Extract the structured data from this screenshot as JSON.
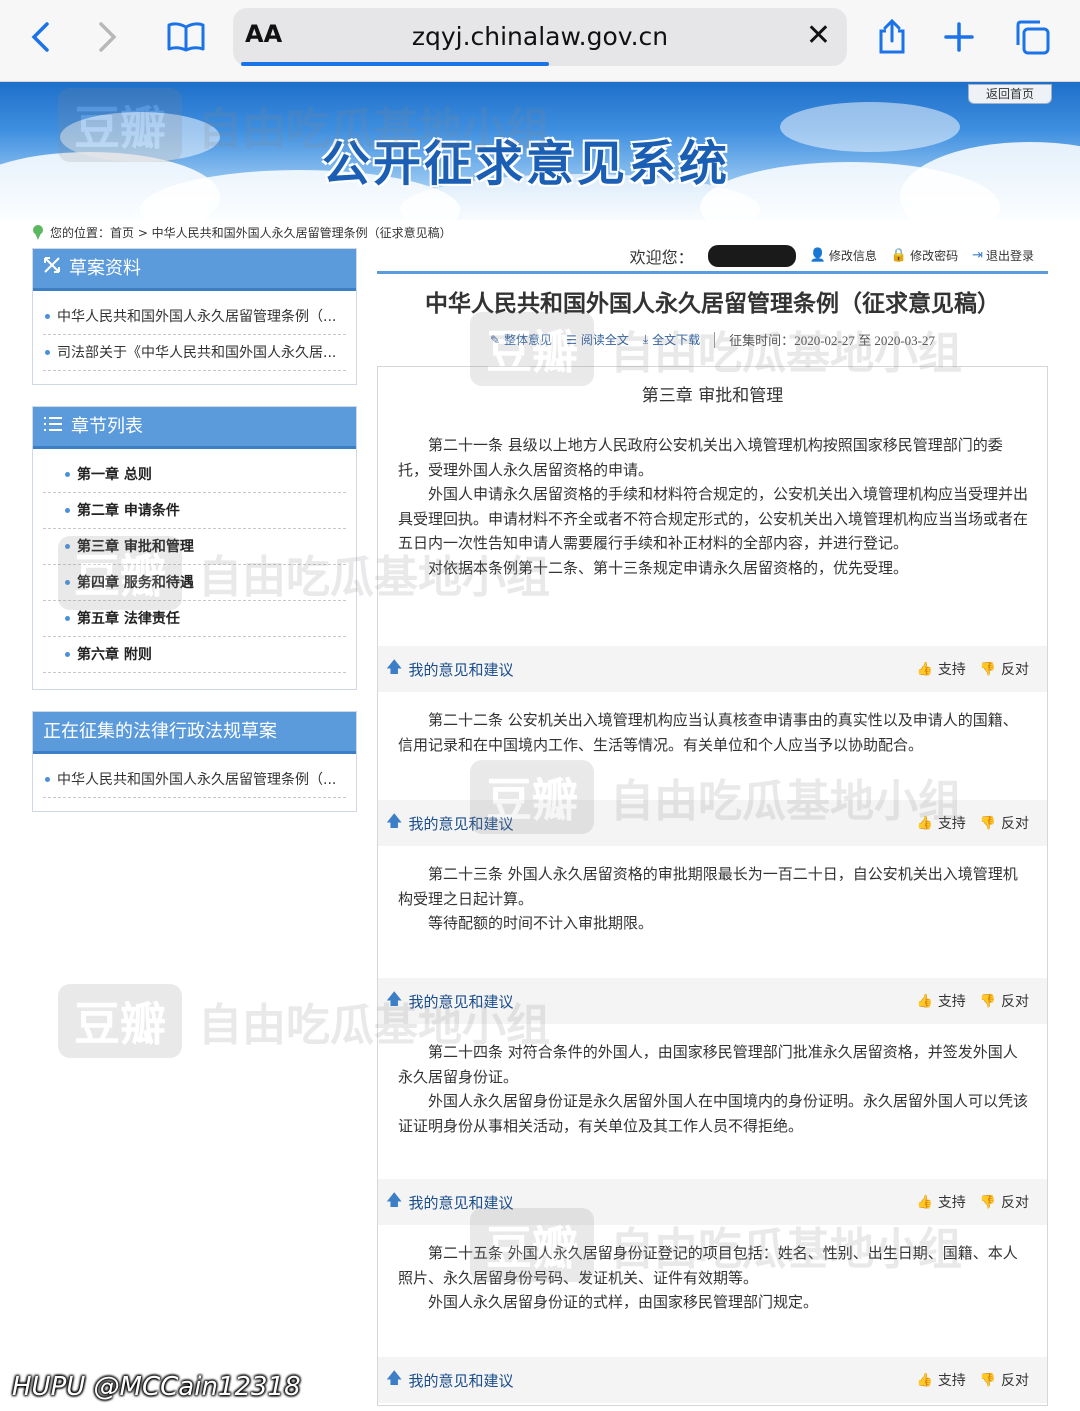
{
  "browser": {
    "url": "zqyj.chinalaw.gov.cn",
    "text_size_label": "AA"
  },
  "banner": {
    "title": "公开征求意见系统",
    "home_button": "返回首页"
  },
  "breadcrumb": {
    "text": "您的位置：首页 > 中华人民共和国外国人永久居留管理条例（征求意见稿）"
  },
  "sidebar": {
    "drafts": {
      "title": "草案资料",
      "items": [
        {
          "label": "中华人民共和国外国人永久居留管理条例（..."
        },
        {
          "label": "司法部关于《中华人民共和国外国人永久居..."
        }
      ]
    },
    "chapters": {
      "title": "章节列表",
      "items": [
        {
          "label": "第一章 总则"
        },
        {
          "label": "第二章 申请条件"
        },
        {
          "label": "第三章 审批和管理"
        },
        {
          "label": "第四章 服务和待遇"
        },
        {
          "label": "第五章 法律责任"
        },
        {
          "label": "第六章 附则"
        }
      ]
    },
    "open_drafts": {
      "title": "正在征集的法律行政法规草案",
      "items": [
        {
          "label": "中华人民共和国外国人永久居留管理条例（..."
        }
      ]
    }
  },
  "user_bar": {
    "welcome": "欢迎您：",
    "edit_info": "修改信息",
    "change_password": "修改密码",
    "logout": "退出登录"
  },
  "document": {
    "title": "中华人民共和国外国人永久居留管理条例（征求意见稿）",
    "tools": {
      "overall_opinion": "整体意见",
      "read_full": "阅读全文",
      "download_full": "全文下载",
      "period_label": "征集时间：",
      "period_value": "2020-02-27 至 2020-03-27"
    },
    "chapter_title": "第三章 审批和管理",
    "articles": [
      {
        "paragraphs": [
          "第二十一条 县级以上地方人民政府公安机关出入境管理机构按照国家移民管理部门的委托，受理外国人永久居留资格的申请。",
          "外国人申请永久居留资格的手续和材料符合规定的，公安机关出入境管理机构应当受理并出具受理回执。申请材料不齐全或者不符合规定形式的，公安机关出入境管理机构应当当场或者在五日内一次性告知申请人需要履行手续和补正材料的全部内容，并进行登记。",
          "对依据本条例第十二条、第十三条规定申请永久居留资格的，优先受理。"
        ]
      },
      {
        "paragraphs": [
          "第二十二条 公安机关出入境管理机构应当认真核查申请事由的真实性以及申请人的国籍、信用记录和在中国境内工作、生活等情况。有关单位和个人应当予以协助配合。"
        ]
      },
      {
        "paragraphs": [
          "第二十三条 外国人永久居留资格的审批期限最长为一百二十日，自公安机关出入境管理机构受理之日起计算。",
          "等待配额的时间不计入审批期限。"
        ]
      },
      {
        "paragraphs": [
          "第二十四条 对符合条件的外国人，由国家移民管理部门批准永久居留资格，并签发外国人永久居留身份证。",
          "外国人永久居留身份证是永久居留外国人在中国境内的身份证明。永久居留外国人可以凭该证证明身份从事相关活动，有关单位及其工作人员不得拒绝。"
        ]
      },
      {
        "paragraphs": [
          "第二十五条 外国人永久居留身份证登记的项目包括：姓名、性别、出生日期、国籍、本人照片、永久居留身份号码、发证机关、证件有效期等。",
          "外国人永久居留身份证的式样，由国家移民管理部门规定。"
        ]
      }
    ],
    "opinion_label": "我的意见和建议",
    "support_label": "支持",
    "oppose_label": "反对"
  },
  "watermark": {
    "badge": "豆瓣",
    "text": "自由吃瓜基地小组"
  },
  "footer_tag": "HUPU @MCCain12318"
}
